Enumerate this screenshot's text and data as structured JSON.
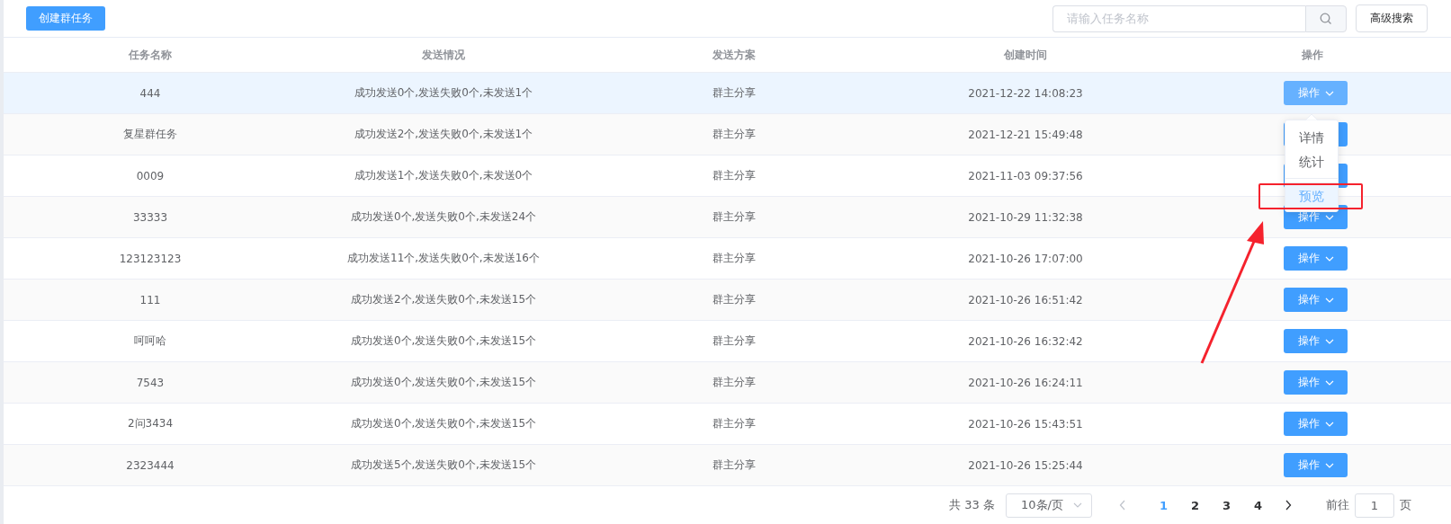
{
  "toolbar": {
    "create_button": "创建群任务",
    "search": {
      "placeholder": "请输入任务名称"
    },
    "advanced_button": "高级搜索"
  },
  "table": {
    "columns": [
      "任务名称",
      "发送情况",
      "发送方案",
      "创建时间",
      "操作"
    ],
    "rows": [
      {
        "name": "444",
        "status": "成功发送0个,发送失败0个,未发送1个",
        "plan": "群主分享",
        "created": "2021-12-22 14:08:23",
        "action": "操作",
        "hovered": true
      },
      {
        "name": "复星群任务",
        "status": "成功发送2个,发送失败0个,未发送1个",
        "plan": "群主分享",
        "created": "2021-12-21 15:49:48",
        "hovered": false
      },
      {
        "name": "0009",
        "status": "成功发送1个,发送失败0个,未发送0个",
        "plan": "群主分享",
        "created": "2021-11-03 09:37:56",
        "hovered": false
      },
      {
        "name": "33333",
        "status": "成功发送0个,发送失败0个,未发送24个",
        "plan": "群主分享",
        "created": "2021-10-29 11:32:38",
        "action": "操作",
        "hovered": false
      },
      {
        "name": "123123123",
        "status": "成功发送11个,发送失败0个,未发送16个",
        "plan": "群主分享",
        "created": "2021-10-26 17:07:00",
        "action": "操作",
        "hovered": false
      },
      {
        "name": "111",
        "status": "成功发送2个,发送失败0个,未发送15个",
        "plan": "群主分享",
        "created": "2021-10-26 16:51:42",
        "action": "操作",
        "hovered": false
      },
      {
        "name": "呵呵哈",
        "status": "成功发送0个,发送失败0个,未发送15个",
        "plan": "群主分享",
        "created": "2021-10-26 16:32:42",
        "action": "操作",
        "hovered": false
      },
      {
        "name": "7543",
        "status": "成功发送0个,发送失败0个,未发送15个",
        "plan": "群主分享",
        "created": "2021-10-26 16:24:11",
        "action": "操作",
        "hovered": false
      },
      {
        "name": "2问3434",
        "status": "成功发送0个,发送失败0个,未发送15个",
        "plan": "群主分享",
        "created": "2021-10-26 15:43:51",
        "action": "操作",
        "hovered": false
      },
      {
        "name": "2323444",
        "status": "成功发送5个,发送失败0个,未发送15个",
        "plan": "群主分享",
        "created": "2021-10-26 15:25:44",
        "action": "操作",
        "hovered": false
      }
    ]
  },
  "dropdown": {
    "items": [
      {
        "label": "详情",
        "highlighted": false,
        "divider_before": false
      },
      {
        "label": "统计",
        "highlighted": false,
        "divider_before": false
      },
      {
        "label": "预览",
        "highlighted": true,
        "divider_before": true
      }
    ]
  },
  "pagination": {
    "total": "共 33 条",
    "page_size": "10条/页",
    "pages": [
      {
        "label": "1",
        "selected": true
      },
      {
        "label": "2",
        "selected": false
      },
      {
        "label": "3",
        "selected": false
      },
      {
        "label": "4",
        "selected": false
      }
    ],
    "goto_label": "前往",
    "goto_value": "1",
    "goto_suffix": "页"
  }
}
